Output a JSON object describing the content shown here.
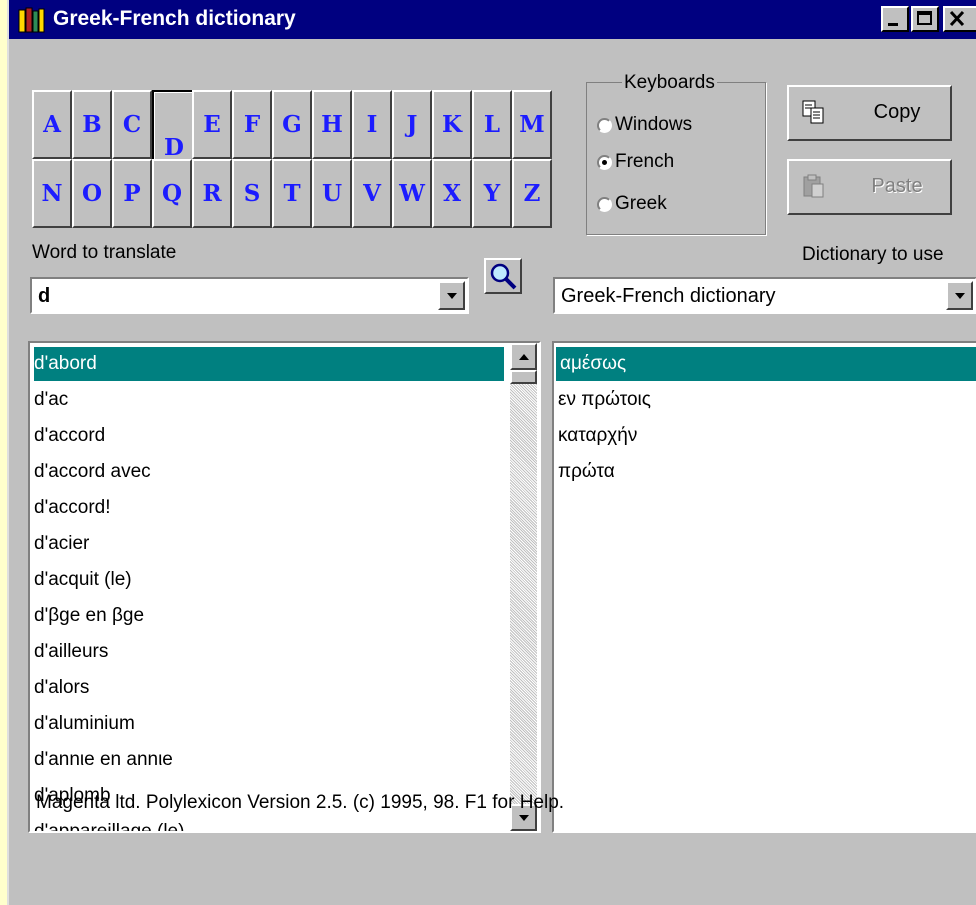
{
  "window": {
    "title": "Greek-French dictionary"
  },
  "alphabet": {
    "row1": [
      "A",
      "B",
      "C",
      "D",
      "E",
      "F",
      "G",
      "H",
      "I",
      "J",
      "K",
      "L",
      "M"
    ],
    "row2": [
      "N",
      "O",
      "P",
      "Q",
      "R",
      "S",
      "T",
      "U",
      "V",
      "W",
      "X",
      "Y",
      "Z"
    ],
    "pressed": "D"
  },
  "keyboards": {
    "legend": "Keyboards",
    "options": [
      "Windows",
      "French",
      "Greek"
    ],
    "selected": "French"
  },
  "buttons": {
    "copy": "Copy",
    "paste": "Paste"
  },
  "search": {
    "label": "Word to translate",
    "value": "d",
    "dictionary_label": "Dictionary to use",
    "dictionary_value": "Greek-French dictionary"
  },
  "words": [
    "d'abord",
    "d'ac",
    "d'accord",
    "d'accord avec",
    "d'accord!",
    "d'acier",
    "d'acquit (le)",
    "d'βge en βge",
    "d'ailleurs",
    "d'alors",
    "d'aluminium",
    "d'annιe en annιe",
    "d'aplomb",
    "d'appareillage (le)"
  ],
  "translations": [
    "αμέσως",
    "εν πρώτοις",
    "καταρχήν",
    "πρώτα"
  ],
  "status": "Magenta ltd. Polylexicon  Version 2.5. (c) 1995, 98. F1 for Help.",
  "colors": {
    "titlebar": "#000080",
    "selection": "#008080",
    "face": "#c0c0c0",
    "letters": "#1c1cff"
  }
}
